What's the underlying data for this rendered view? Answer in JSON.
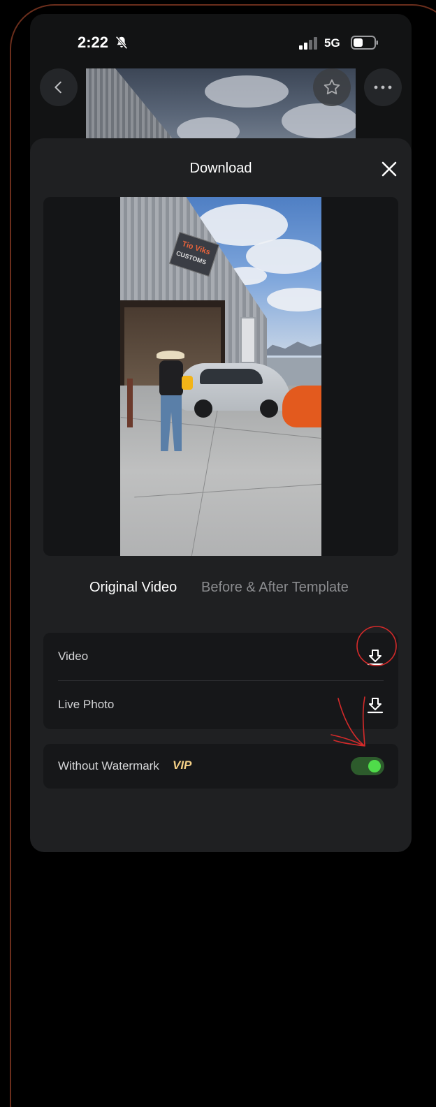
{
  "status_bar": {
    "time": "2:22",
    "network": "5G",
    "icons": [
      "bell-slash-icon",
      "signal-icon",
      "battery-icon"
    ]
  },
  "nav": {
    "icons": [
      "chevron-left-icon",
      "star-icon",
      "more-icon"
    ]
  },
  "sheet": {
    "title": "Download",
    "close_icon": "close-icon"
  },
  "preview": {
    "sign_line1": "Tio Viks",
    "sign_line2": "CUSTOMS"
  },
  "tabs": [
    {
      "label": "Original Video",
      "active": true
    },
    {
      "label": "Before & After Template",
      "active": false
    }
  ],
  "options": [
    {
      "label": "Video",
      "icon": "download-icon"
    },
    {
      "label": "Live Photo",
      "icon": "download-icon"
    }
  ],
  "watermark": {
    "label": "Without Watermark",
    "badge": "VIP",
    "enabled": true
  },
  "colors": {
    "sheet_bg": "#1f2022",
    "card_bg": "#161719",
    "vip_gold": "#f3cf86",
    "toggle_on": "#4fdc4a",
    "annotation_red": "#d42a2a",
    "frame_border": "#6b2e1c"
  }
}
